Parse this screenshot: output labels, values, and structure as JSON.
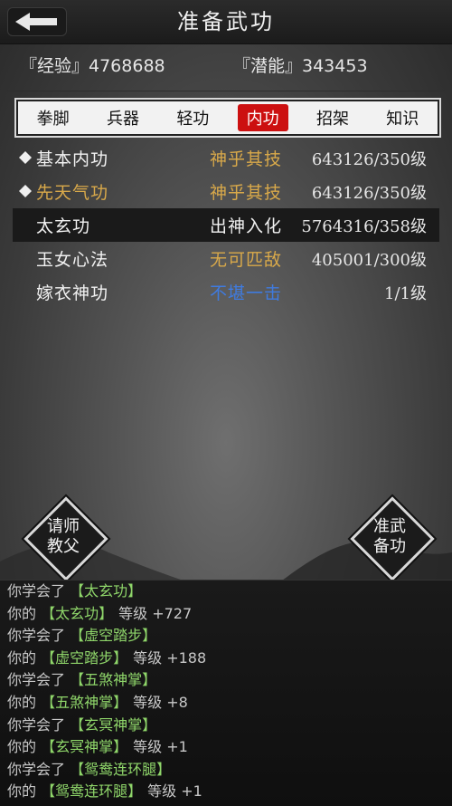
{
  "header": {
    "title": "准备武功"
  },
  "stats": {
    "experience": "『经验』4768688",
    "potential": "『潜能』343453"
  },
  "tabs": [
    {
      "label": "拳脚",
      "active": false
    },
    {
      "label": "兵器",
      "active": false
    },
    {
      "label": "轻功",
      "active": false
    },
    {
      "label": "内功",
      "active": true
    },
    {
      "label": "招架",
      "active": false
    },
    {
      "label": "知识",
      "active": false
    }
  ],
  "colors": {
    "gold": "#d9a94a",
    "blue": "#3f7be0",
    "active_tab": "#cc1010",
    "log_green": "#8fd66a"
  },
  "skills": [
    {
      "name": "基本内功",
      "grade": "神乎其技",
      "level": "643126/350级",
      "marked": true,
      "selected": false,
      "grade_color": "#d9a94a"
    },
    {
      "name": "先天气功",
      "grade": "神乎其技",
      "level": "643126/350级",
      "marked": true,
      "selected": false,
      "grade_color": "#d9a94a",
      "name_color": "#d9a94a"
    },
    {
      "name": "太玄功",
      "grade": "出神入化",
      "level": "5764316/358级",
      "marked": false,
      "selected": true,
      "grade_color": "#f2f2f2"
    },
    {
      "name": "玉女心法",
      "grade": "无可匹敌",
      "level": "405001/300级",
      "marked": false,
      "selected": false,
      "grade_color": "#d9a94a"
    },
    {
      "name": "嫁衣神功",
      "grade": "不堪一击",
      "level": "1/1级",
      "marked": false,
      "selected": false,
      "grade_color": "#3f7be0"
    }
  ],
  "buttons": {
    "ask_master": [
      "请师",
      "教父"
    ],
    "prepare": [
      "准武",
      "备功"
    ]
  },
  "log": [
    {
      "prefix": "你学会了",
      "skill": "【太玄功】",
      "suffix": ""
    },
    {
      "prefix": "你的",
      "skill": "【太玄功】",
      "suffix": "等级 +727"
    },
    {
      "prefix": "你学会了",
      "skill": "【虚空踏步】",
      "suffix": ""
    },
    {
      "prefix": "你的",
      "skill": "【虚空踏步】",
      "suffix": "等级 +188"
    },
    {
      "prefix": "你学会了",
      "skill": "【五煞神掌】",
      "suffix": ""
    },
    {
      "prefix": "你的",
      "skill": "【五煞神掌】",
      "suffix": "等级 +8"
    },
    {
      "prefix": "你学会了",
      "skill": "【玄冥神掌】",
      "suffix": ""
    },
    {
      "prefix": "你的",
      "skill": "【玄冥神掌】",
      "suffix": "等级 +1"
    },
    {
      "prefix": "你学会了",
      "skill": "【鸳鸯连环腿】",
      "suffix": ""
    },
    {
      "prefix": "你的",
      "skill": "【鸳鸯连环腿】",
      "suffix": "等级 +1"
    }
  ]
}
